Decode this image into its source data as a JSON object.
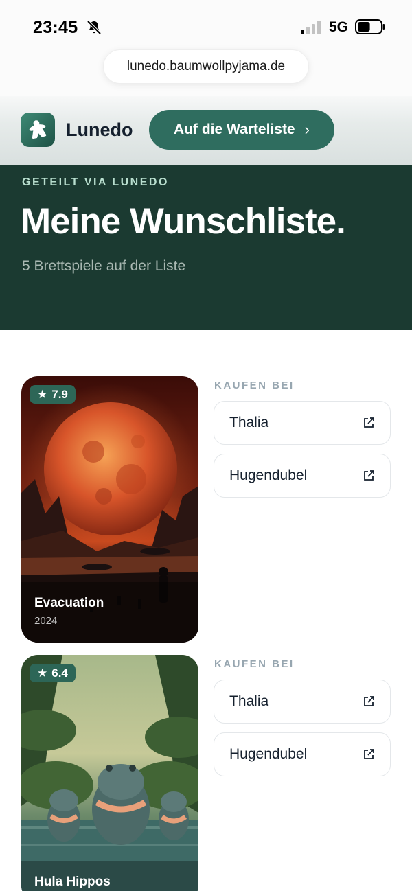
{
  "status_bar": {
    "time": "23:45",
    "network": "5G",
    "battery_level": 0.55
  },
  "browser": {
    "url": "lunedo.baumwollpyjama.de"
  },
  "header": {
    "brand": "Lunedo",
    "cta_label": "Auf die Warteliste"
  },
  "hero": {
    "eyebrow": "GETEILT VIA LUNEDO",
    "title": "Meine Wunschliste.",
    "subtitle": "5 Brettspiele auf der Liste"
  },
  "games": [
    {
      "title": "Evacuation",
      "year": "2024",
      "rating": "7.9",
      "buy_label": "KAUFEN BEI",
      "shops": [
        "Thalia",
        "Hugendubel"
      ]
    },
    {
      "title": "Hula Hippos",
      "rating": "6.4",
      "buy_label": "KAUFEN BEI",
      "shops": [
        "Thalia",
        "Hugendubel"
      ]
    }
  ],
  "colors": {
    "hero_bg": "#1b3a31",
    "brand_green": "#2f6d5f",
    "rating_bg": "#2d6657"
  },
  "icons": {
    "status": [
      "bell-slash-icon",
      "signal-icon",
      "battery-icon"
    ],
    "cta": "chevron-right-icon",
    "rating": "star-icon",
    "shop": "external-link-icon"
  }
}
